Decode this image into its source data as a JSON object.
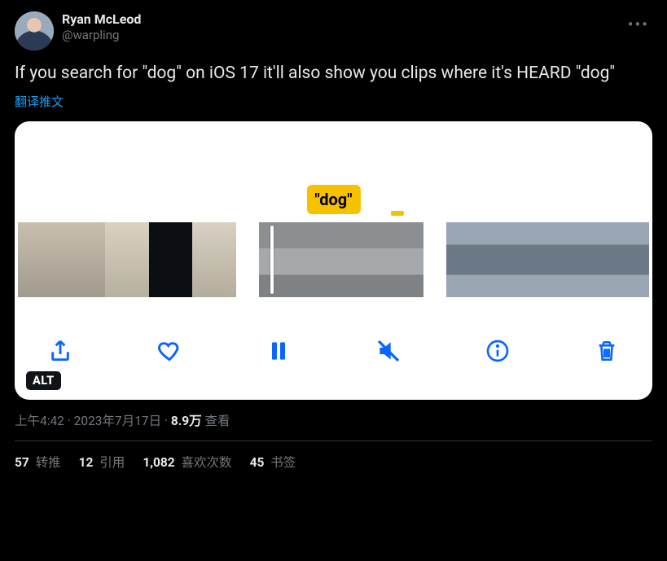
{
  "author": {
    "display_name": "Ryan McLeod",
    "handle": "@warpling"
  },
  "tweet_text": "If you search for \"dog\" on iOS 17 it'll also show you clips where it's HEARD \"dog\"",
  "translate_label": "翻译推文",
  "media": {
    "caption_badge": "\"dog\"",
    "alt_badge": "ALT",
    "toolbar": {
      "share": "share",
      "like": "like",
      "pause": "pause",
      "mute": "mute",
      "info": "info",
      "delete": "delete"
    }
  },
  "meta": {
    "time": "上午4:42",
    "date": "2023年7月17日",
    "views_value": "8.9万",
    "views_label": " 查看",
    "sep": " · "
  },
  "stats": {
    "retweets": {
      "count": "57",
      "label": " 转推"
    },
    "quotes": {
      "count": "12",
      "label": " 引用"
    },
    "likes": {
      "count": "1,082",
      "label": " 喜欢次数"
    },
    "bookmarks": {
      "count": "45",
      "label": " 书签"
    }
  }
}
